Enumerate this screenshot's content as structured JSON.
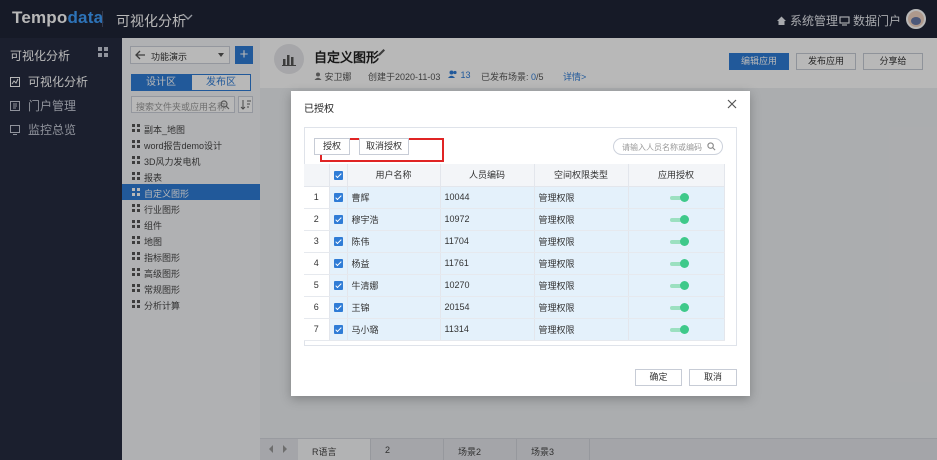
{
  "topbar": {
    "logo_main": "Tempo",
    "logo_accent": "data",
    "app_title": "可视化分析",
    "system_admin": "系统管理",
    "data_portal": "数据门户"
  },
  "leftnav": {
    "header": "可视化分析",
    "items": [
      {
        "label": "可视化分析",
        "icon": "chart-icon"
      },
      {
        "label": "门户管理",
        "icon": "portal-icon"
      },
      {
        "label": "监控总览",
        "icon": "monitor-icon"
      }
    ]
  },
  "filepanel": {
    "combo_value": "功能演示",
    "plus": "+",
    "tab_design": "设计区",
    "tab_publish": "发布区",
    "search_placeholder": "搜索文件夹或应用名称",
    "items": [
      "副本_地图",
      "word报告demo设计",
      "3D风力发电机",
      "报表",
      "自定义图形",
      "行业图形",
      "组件",
      "地图",
      "指标图形",
      "高级图形",
      "常规图形",
      "分析计算"
    ],
    "selected_index": 4
  },
  "header": {
    "title": "自定义图形",
    "author": "安卫娜",
    "created": "创建于2020-11-03",
    "user_count": "13",
    "publish_label": "已发布场景:",
    "publish_value": "0",
    "publish_total": "/5",
    "details": "详情>",
    "edit_app": "编辑应用",
    "publish_app": "发布应用",
    "share": "分享给"
  },
  "bottom_tabs": [
    "R语言",
    "2",
    "场景2",
    "场景3"
  ],
  "modal": {
    "title": "已授权",
    "grant": "授权",
    "revoke": "取消授权",
    "search_placeholder": "请输入人员名称或编码",
    "columns": {
      "name": "用户名称",
      "code": "人员编码",
      "perm": "空间权限类型",
      "auth": "应用授权"
    },
    "rows": [
      {
        "idx": "1",
        "name": "曹辉",
        "code": "10044",
        "perm": "管理权限",
        "auth": true
      },
      {
        "idx": "2",
        "name": "穆宇浩",
        "code": "10972",
        "perm": "管理权限",
        "auth": true
      },
      {
        "idx": "3",
        "name": "陈伟",
        "code": "11704",
        "perm": "管理权限",
        "auth": true
      },
      {
        "idx": "4",
        "name": "杨益",
        "code": "11761",
        "perm": "管理权限",
        "auth": true
      },
      {
        "idx": "5",
        "name": "牛清娜",
        "code": "10270",
        "perm": "管理权限",
        "auth": true
      },
      {
        "idx": "6",
        "name": "王锦",
        "code": "20154",
        "perm": "管理权限",
        "auth": true
      },
      {
        "idx": "7",
        "name": "马小璐",
        "code": "11314",
        "perm": "管理权限",
        "auth": true
      }
    ],
    "ok": "确定",
    "cancel": "取消"
  },
  "colors": {
    "primary": "#2f7cd6",
    "topbar": "#1f2436",
    "highlight": "#e02424",
    "toggle": "#3ec98a"
  }
}
